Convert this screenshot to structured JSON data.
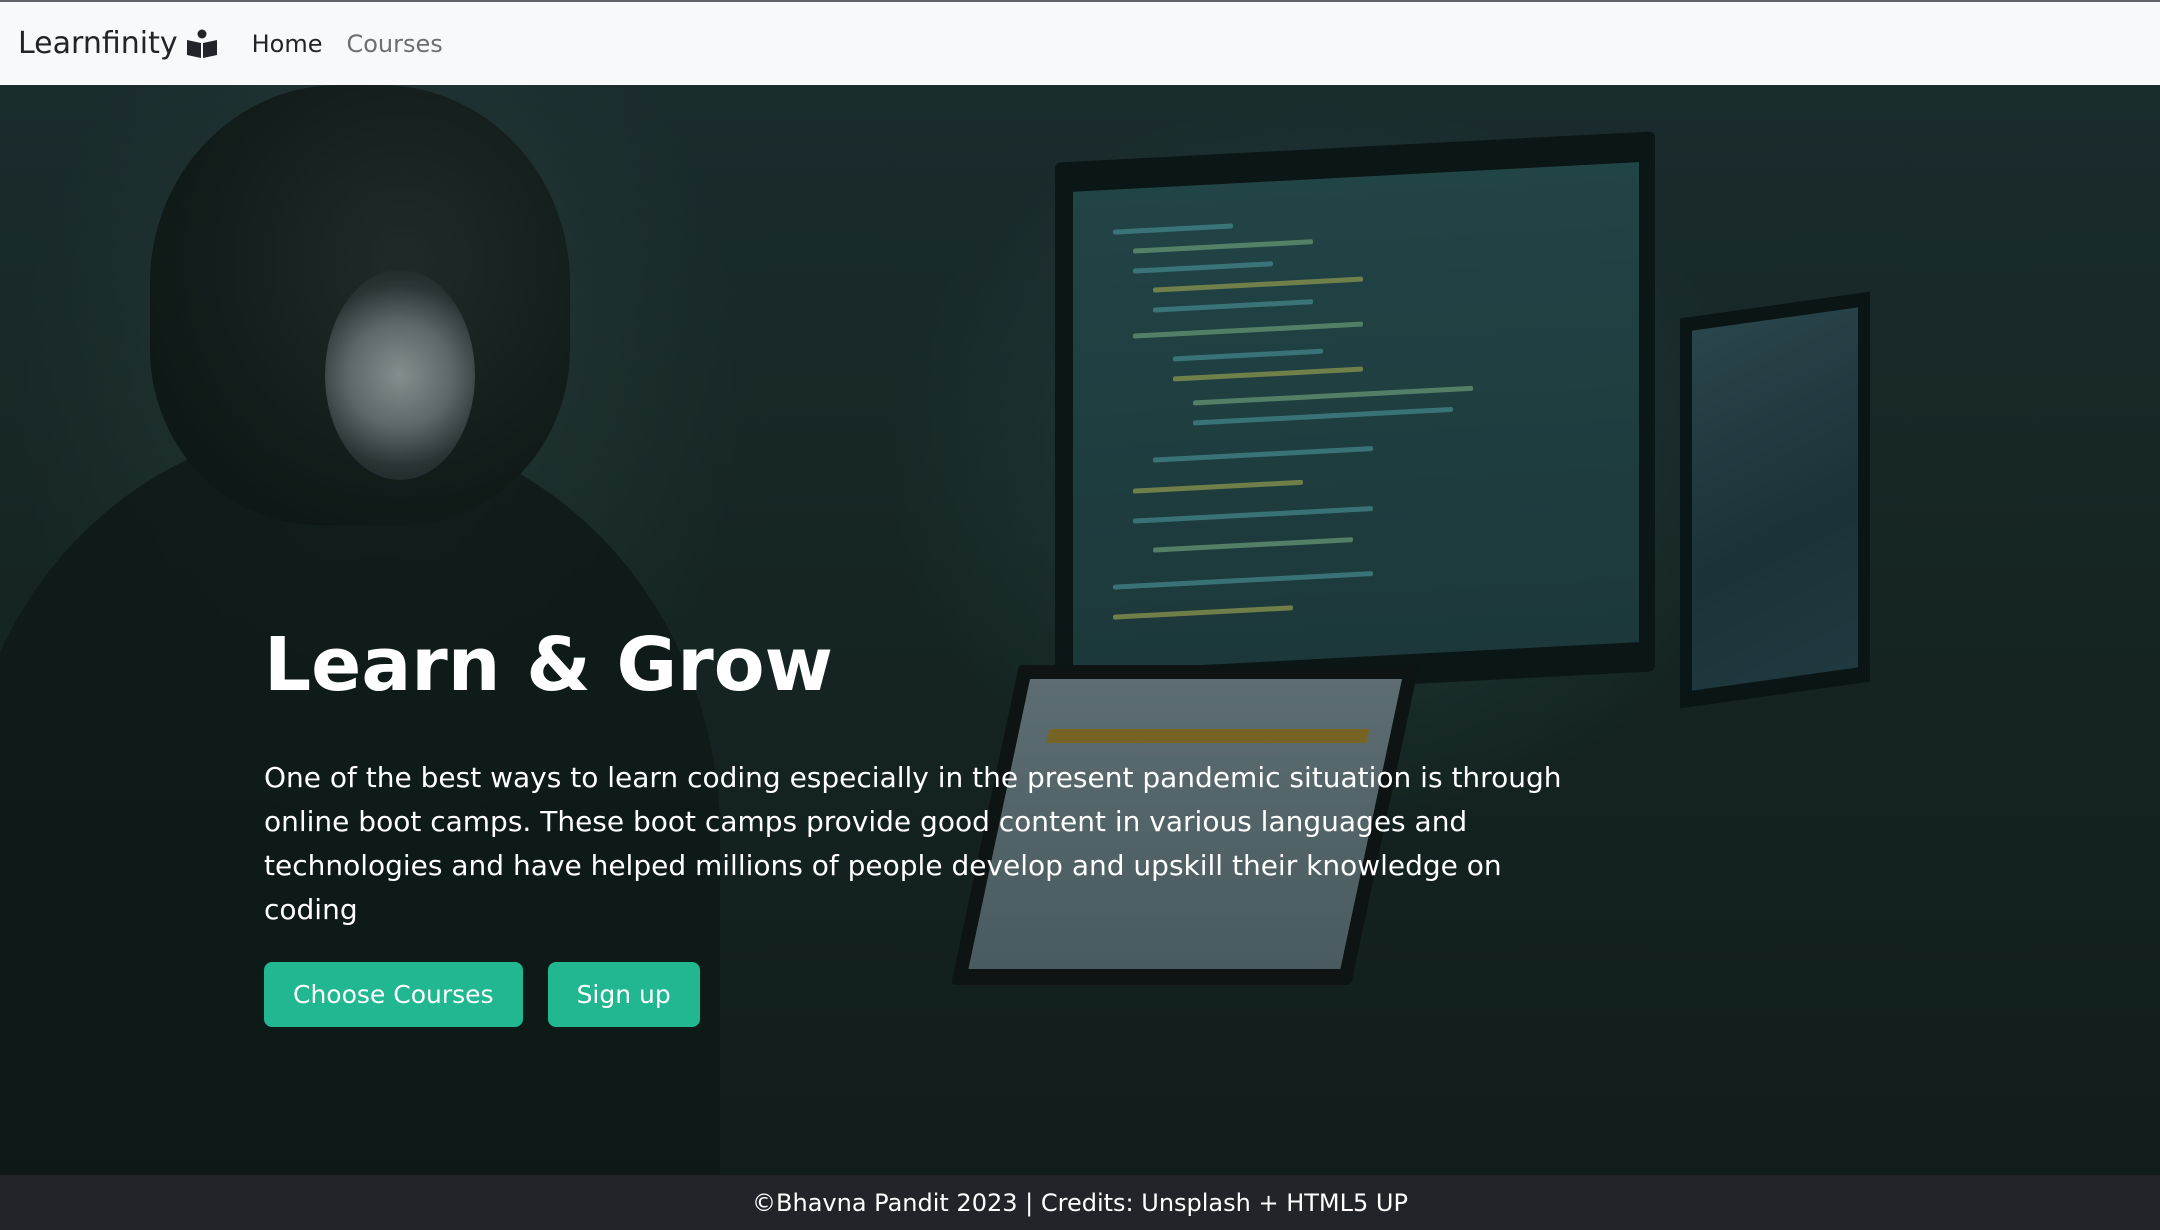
{
  "navbar": {
    "brand": "Learnfinity",
    "brand_icon": "book-reader-icon",
    "links": [
      {
        "label": "Home",
        "active": true
      },
      {
        "label": "Courses",
        "active": false
      }
    ]
  },
  "hero": {
    "title": "Learn & Grow",
    "text": "One of the best ways to learn coding especially in the present pandemic situation is through online boot camps. These boot camps provide good content in various languages and technologies and have helped millions of people develop and upskill their knowledge on coding",
    "buttons": {
      "choose_courses": "Choose Courses",
      "sign_up": "Sign up"
    },
    "background_image": "programmer-with-headphones-photo"
  },
  "footer": {
    "text": "©Bhavna Pandit 2023 | Credits: Unsplash + HTML5 UP"
  },
  "colors": {
    "accent": "#20b791",
    "navbar_bg": "#f8f9fa",
    "footer_bg": "#212529"
  }
}
